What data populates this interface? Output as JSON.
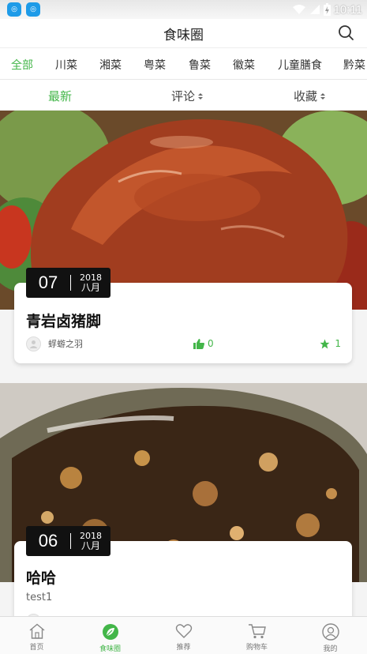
{
  "status_bar": {
    "time": "10:11"
  },
  "header": {
    "title": "食味圈"
  },
  "categories": [
    {
      "label": "全部",
      "active": true
    },
    {
      "label": "川菜"
    },
    {
      "label": "湘菜"
    },
    {
      "label": "粤菜"
    },
    {
      "label": "鲁菜"
    },
    {
      "label": "徽菜"
    },
    {
      "label": "儿童膳食"
    },
    {
      "label": "黔菜"
    }
  ],
  "sort": [
    {
      "label": "最新",
      "active": true
    },
    {
      "label": "评论"
    },
    {
      "label": "收藏"
    }
  ],
  "posts": [
    {
      "day": "07",
      "year": "2018",
      "month": "八月",
      "title": "青岩卤猪脚",
      "author": "蜉蝣之羽",
      "likes": "0",
      "favorites": "1"
    },
    {
      "day": "06",
      "year": "2018",
      "month": "八月",
      "title": "哈哈",
      "subtitle": "test1"
    }
  ],
  "bottom_nav": [
    {
      "label": "首页",
      "icon": "home-icon"
    },
    {
      "label": "食味圈",
      "icon": "leaf-icon",
      "active": true
    },
    {
      "label": "推荐",
      "icon": "heart-icon"
    },
    {
      "label": "购物车",
      "icon": "cart-icon"
    },
    {
      "label": "我的",
      "icon": "user-icon"
    }
  ],
  "colors": {
    "accent": "#43b649",
    "badge": "#111111"
  }
}
